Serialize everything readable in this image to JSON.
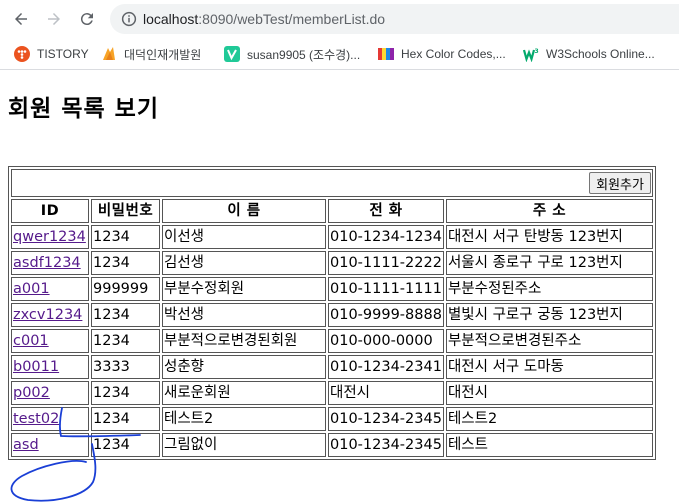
{
  "browser": {
    "url_host": "localhost",
    "url_rest": ":8090/webTest/memberList.do",
    "bookmarks": [
      {
        "label": "TISTORY",
        "icon": "tistory-icon"
      },
      {
        "label": "대덕인재개발원",
        "icon": "bookmark-favicon-icon"
      },
      {
        "label": "susan9905 (조수경)...",
        "icon": "velog-icon"
      },
      {
        "label": "Hex Color Codes,...",
        "icon": "color-codes-icon"
      },
      {
        "label": "W3Schools Online...",
        "icon": "w3schools-icon"
      }
    ]
  },
  "page": {
    "title": "회원 목록 보기",
    "add_button_label": "회원추가"
  },
  "table": {
    "headers": [
      "ID",
      "비밀번호",
      "이 름",
      "전 화",
      "주 소"
    ],
    "rows": [
      {
        "id": "qwer1234",
        "pw": "1234",
        "name": "이선생",
        "tel": "010-1234-1234",
        "addr": "대전시 서구 탄방동 123번지"
      },
      {
        "id": "asdf1234",
        "pw": "1234",
        "name": "김선생",
        "tel": "010-1111-2222",
        "addr": "서울시 종로구 구로 123번지"
      },
      {
        "id": "a001",
        "pw": "999999",
        "name": "부분수정회원",
        "tel": "010-1111-1111",
        "addr": "부분수정된주소"
      },
      {
        "id": "zxcv1234",
        "pw": "1234",
        "name": "박선생",
        "tel": "010-9999-8888",
        "addr": "별빛시 구로구 궁동 123번지"
      },
      {
        "id": "c001",
        "pw": "1234",
        "name": "부분적으로변경된회원",
        "tel": "010-000-0000",
        "addr": "부분적으로변경된주소"
      },
      {
        "id": "b0011",
        "pw": "3333",
        "name": "성춘향",
        "tel": "010-1234-2341",
        "addr": "대전시 서구 도마동"
      },
      {
        "id": "p002",
        "pw": "1234",
        "name": "새로운회원",
        "tel": "대전시",
        "addr": "대전시"
      },
      {
        "id": "test02",
        "pw": "1234",
        "name": "테스트2",
        "tel": "010-1234-2345",
        "addr": "테스트2"
      },
      {
        "id": "asd",
        "pw": "1234",
        "name": "그림없이",
        "tel": "010-1234-2345",
        "addr": "테스트"
      }
    ]
  },
  "colors": {
    "link": "#551a8b",
    "annotation_ink": "#1a3fd6"
  }
}
